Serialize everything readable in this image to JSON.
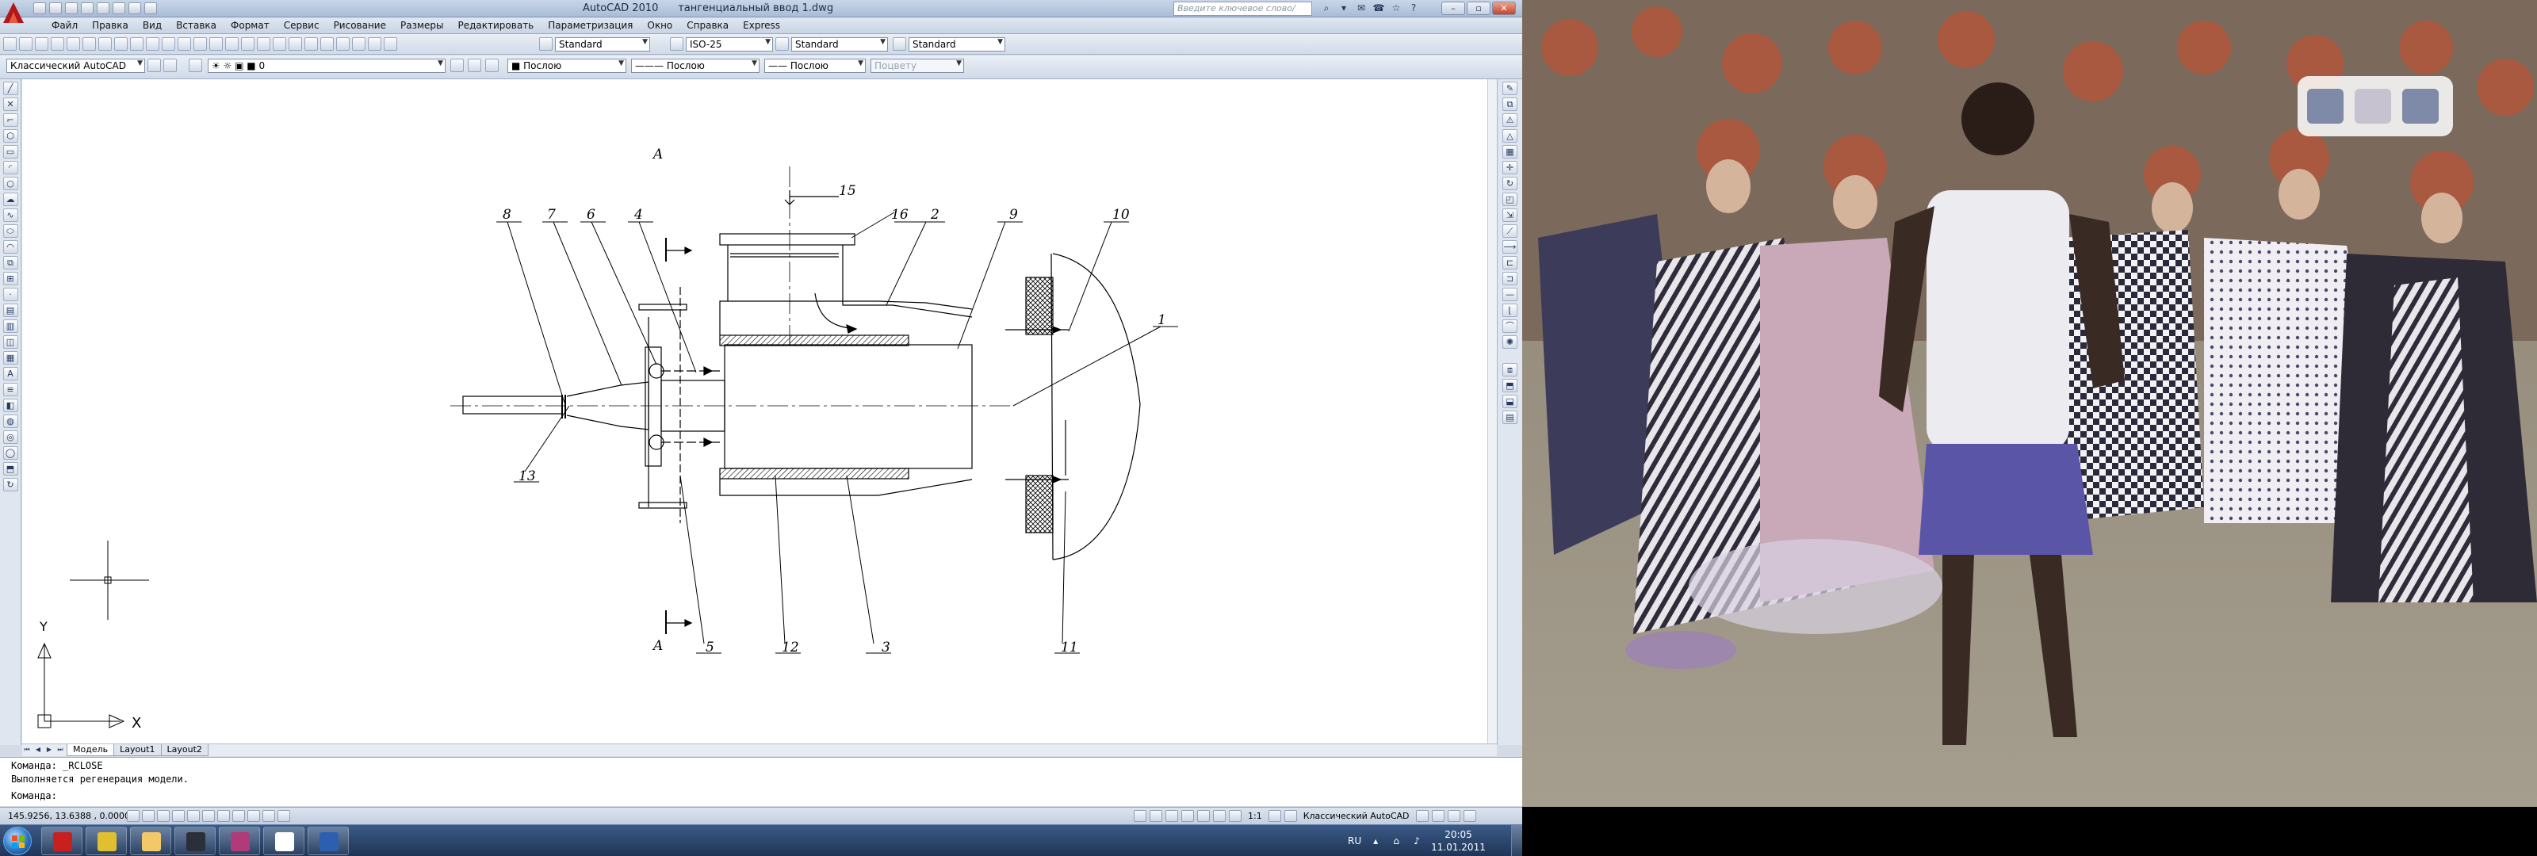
{
  "window": {
    "title": "AutoCAD 2010",
    "file": "тангенциальный ввод 1.dwg",
    "search_placeholder": "Введите ключевое слово/фразу"
  },
  "menu": [
    "Файл",
    "Правка",
    "Вид",
    "Вставка",
    "Формат",
    "Сервис",
    "Рисование",
    "Размеры",
    "Редактировать",
    "Параметризация",
    "Окно",
    "Справка",
    "Express"
  ],
  "toolbar1": {
    "text_style": "Standard",
    "dim_style": "ISO-25",
    "table_style": "Standard",
    "mleader_style": "Standard"
  },
  "toolbar2": {
    "workspace": "Классический AutoCAD",
    "layer": "0",
    "color": "Послою",
    "linetype": "Послою",
    "lineweight": "Послою",
    "plotstyle": "Поцвету"
  },
  "drawing": {
    "section_mark": "A",
    "leaders": [
      "1",
      "2",
      "3",
      "4",
      "5",
      "6",
      "7",
      "8",
      "9",
      "10",
      "11",
      "12",
      "13",
      "15",
      "16"
    ]
  },
  "ucs": {
    "x_label": "X",
    "y_label": "Y"
  },
  "tabs": [
    "Модель",
    "Layout1",
    "Layout2"
  ],
  "command": {
    "line1": "Команда: _RCLOSE",
    "line2": "Выполняется регенерация модели.",
    "prompt": "Команда:"
  },
  "status": {
    "coords": "145.9256, 13.6388 , 0.0000",
    "scale": "1:1",
    "workspace": "Классический AutoCAD"
  },
  "taskbar": {
    "language": "RU",
    "time": "20:05",
    "date": "11.01.2011"
  },
  "colors": {
    "titlebar": "#a9bcd6",
    "canvas": "#ffffff",
    "taskbar": "#1e3557"
  }
}
